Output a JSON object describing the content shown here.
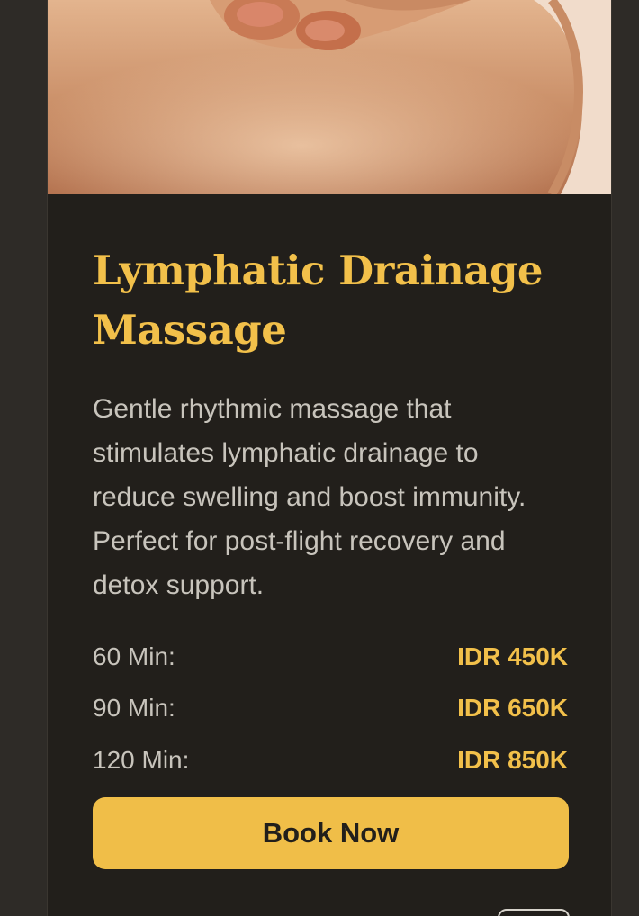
{
  "service": {
    "title": "Lymphatic Drainage Massage",
    "description": "Gentle rhythmic massage that stimulates lymphatic drainage to reduce swelling and boost immunity. Perfect for post-flight recovery and detox support.",
    "prices": [
      {
        "label": "60 Min:",
        "value": "IDR 450K"
      },
      {
        "label": "90 Min:",
        "value": "IDR 650K"
      },
      {
        "label": "120 Min:",
        "value": "IDR 850K"
      }
    ],
    "book_label": "Book Now"
  },
  "colors": {
    "accent": "#f0be48",
    "card_background": "#221f1b",
    "page_background": "#2e2b27",
    "text_muted": "#c8c4bc"
  }
}
